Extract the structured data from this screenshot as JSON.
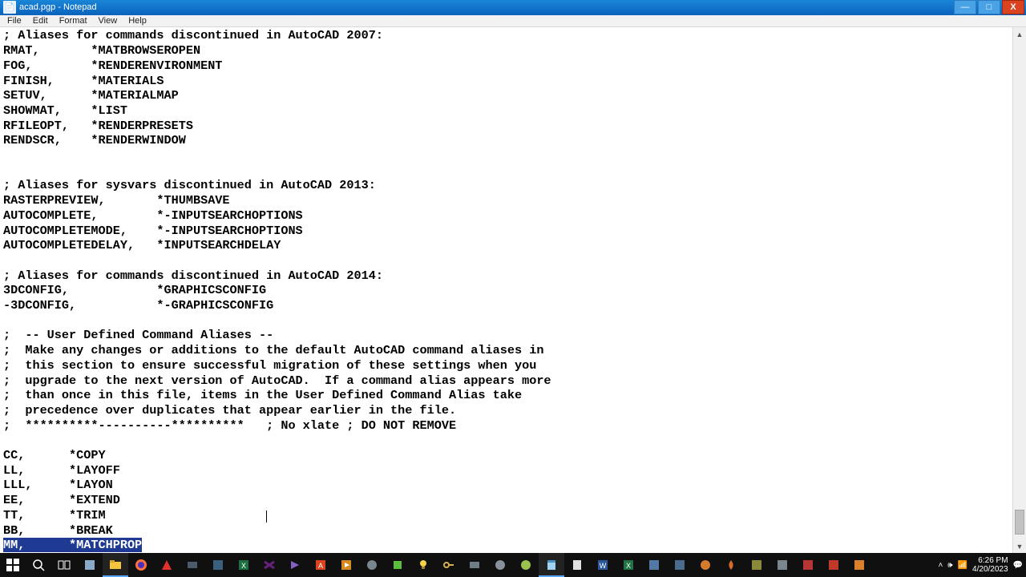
{
  "titlebar": {
    "icon_glyph": "📄",
    "title": "acad.pgp - Notepad"
  },
  "menu": {
    "file": "File",
    "edit": "Edit",
    "format": "Format",
    "view": "View",
    "help": "Help"
  },
  "lines": [
    "; Aliases for commands discontinued in AutoCAD 2007:",
    "RMAT,       *MATBROWSEROPEN",
    "FOG,        *RENDERENVIRONMENT",
    "FINISH,     *MATERIALS",
    "SETUV,      *MATERIALMAP",
    "SHOWMAT,    *LIST",
    "RFILEOPT,   *RENDERPRESETS",
    "RENDSCR,    *RENDERWINDOW",
    "",
    "",
    "; Aliases for sysvars discontinued in AutoCAD 2013:",
    "RASTERPREVIEW,       *THUMBSAVE",
    "AUTOCOMPLETE,        *-INPUTSEARCHOPTIONS",
    "AUTOCOMPLETEMODE,    *-INPUTSEARCHOPTIONS",
    "AUTOCOMPLETEDELAY,   *INPUTSEARCHDELAY",
    "",
    "; Aliases for commands discontinued in AutoCAD 2014:",
    "3DCONFIG,            *GRAPHICSCONFIG",
    "-3DCONFIG,           *-GRAPHICSCONFIG",
    "",
    ";  -- User Defined Command Aliases --",
    ";  Make any changes or additions to the default AutoCAD command aliases in",
    ";  this section to ensure successful migration of these settings when you",
    ";  upgrade to the next version of AutoCAD.  If a command alias appears more",
    ";  than once in this file, items in the User Defined Command Alias take",
    ";  precedence over duplicates that appear earlier in the file.",
    ";  **********----------**********   ; No xlate ; DO NOT REMOVE",
    "",
    "CC,      *COPY",
    "LL,      *LAYOFF",
    "LLL,     *LAYON",
    "EE,      *EXTEND",
    "TT,      *TRIM",
    "BB,      *BREAK"
  ],
  "selected_line": "MM,      *MATCHPROP",
  "scrollbar": {
    "thumb_top_pct": 94,
    "thumb_height_pct": 5
  },
  "tray": {
    "time": "6:26 PM",
    "date": "4/20/2023"
  }
}
